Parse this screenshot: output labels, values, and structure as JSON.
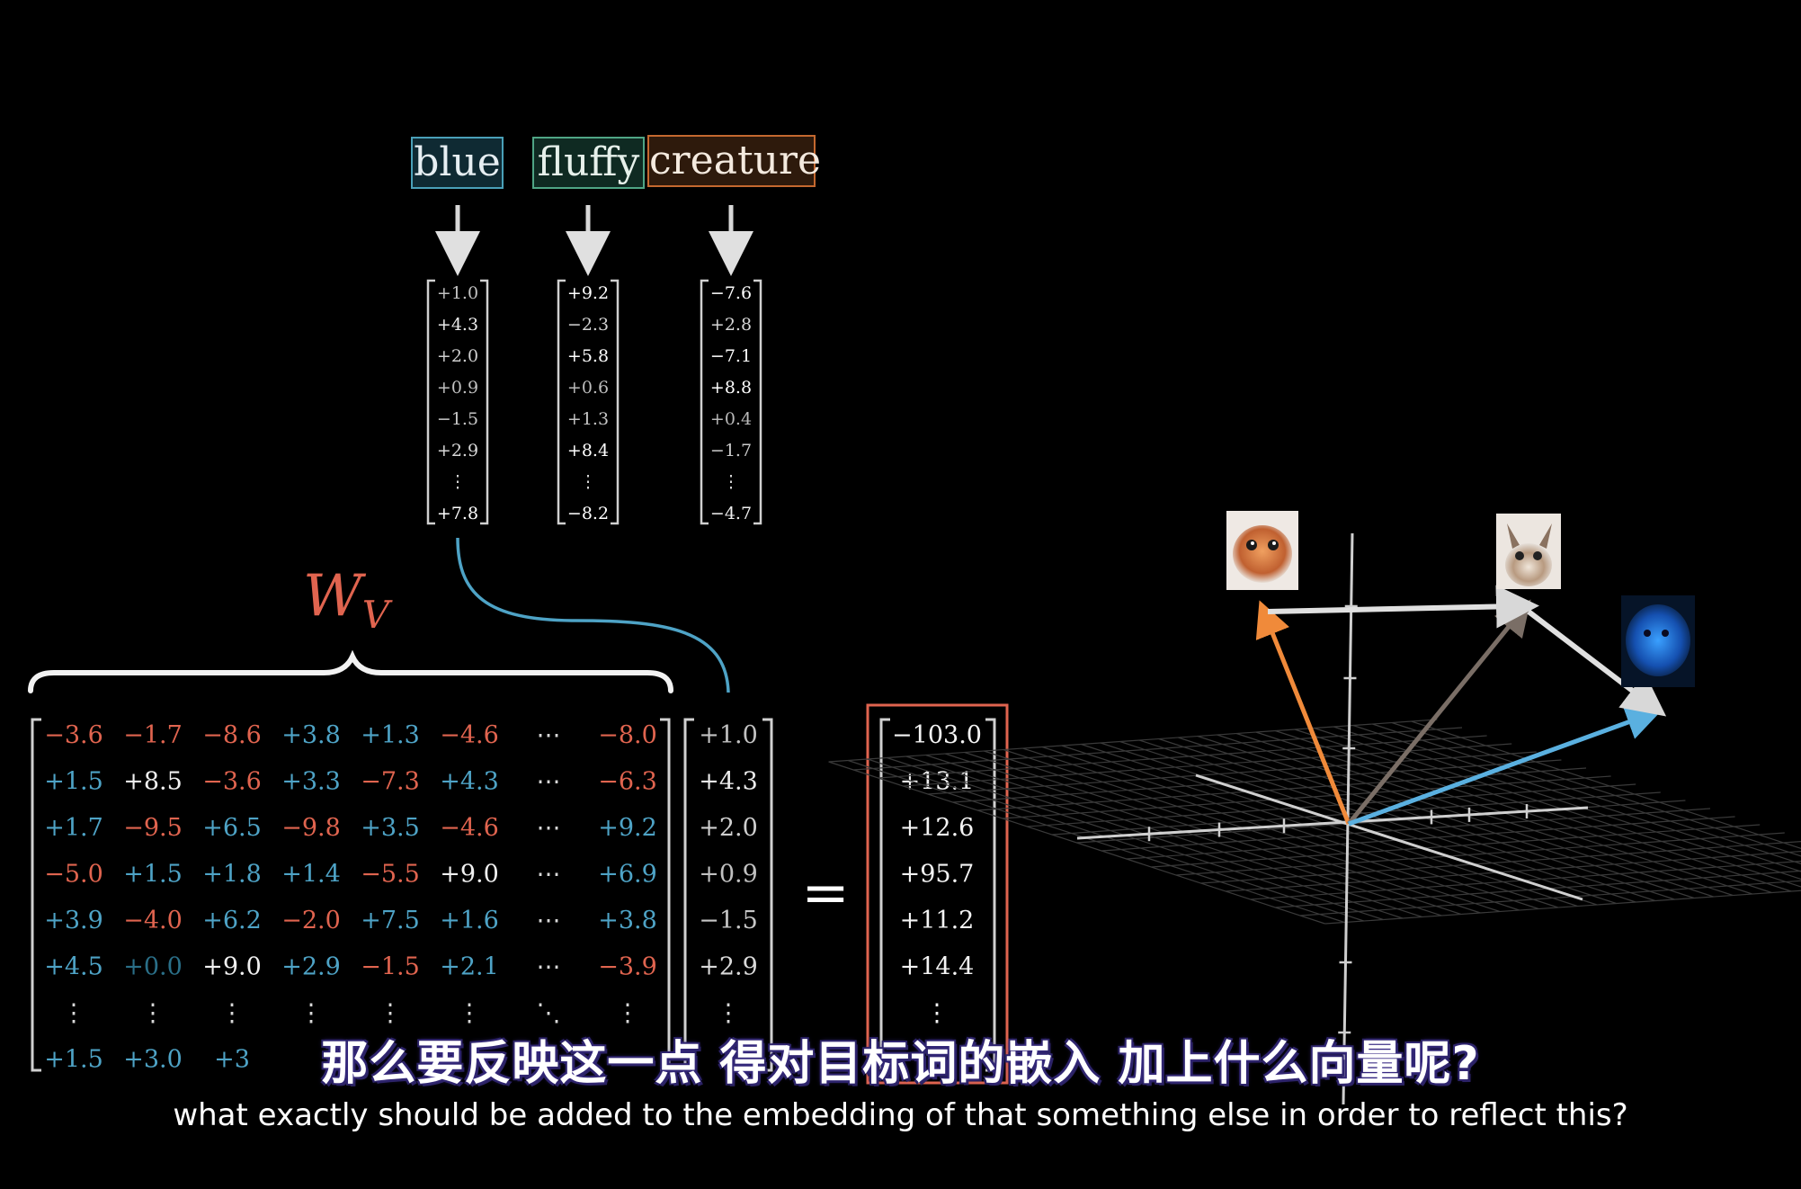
{
  "tokens": [
    {
      "label": "blue",
      "vector": [
        "+1.0",
        "+4.3",
        "+2.0",
        "+0.9",
        "−1.5",
        "+2.9",
        "⋮",
        "+7.8"
      ]
    },
    {
      "label": "fluffy",
      "vector": [
        "+9.2",
        "−2.3",
        "+5.8",
        "+0.6",
        "+1.3",
        "+8.4",
        "⋮",
        "−8.2"
      ]
    },
    {
      "label": "creature",
      "vector": [
        "−7.6",
        "+2.8",
        "−7.1",
        "+8.8",
        "+0.4",
        "−1.7",
        "⋮",
        "−4.7"
      ]
    }
  ],
  "matrix_label": {
    "base": "W",
    "subscript": "V"
  },
  "matrix_rows": [
    [
      "−3.6",
      "−1.7",
      "−8.6",
      "+3.8",
      "+1.3",
      "−4.6",
      "⋯",
      "−8.0"
    ],
    [
      "+1.5",
      "+8.5",
      "−3.6",
      "+3.3",
      "−7.3",
      "+4.3",
      "⋯",
      "−6.3"
    ],
    [
      "+1.7",
      "−9.5",
      "+6.5",
      "−9.8",
      "+3.5",
      "−4.6",
      "⋯",
      "+9.2"
    ],
    [
      "−5.0",
      "+1.5",
      "+1.8",
      "+1.4",
      "−5.5",
      "+9.0",
      "⋯",
      "+6.9"
    ],
    [
      "+3.9",
      "−4.0",
      "+6.2",
      "−2.0",
      "+7.5",
      "+1.6",
      "⋯",
      "+3.8"
    ],
    [
      "+4.5",
      "+0.0",
      "+9.0",
      "+2.9",
      "−1.5",
      "+2.1",
      "⋯",
      "−3.9"
    ],
    [
      "⋮",
      "⋮",
      "⋮",
      "⋮",
      "⋮",
      "⋮",
      "⋱",
      "⋮"
    ],
    [
      "+1.5",
      "+3.0",
      "+3",
      "",
      "",
      "",
      "",
      ""
    ]
  ],
  "input_vector": [
    "+1.0",
    "+4.3",
    "+2.0",
    "+0.9",
    "−1.5",
    "+2.9",
    "⋮"
  ],
  "equals_sign": "=",
  "output_vector": [
    "−103.0",
    "+13.1",
    "+12.6",
    "+95.7",
    "+11.2",
    "+14.4",
    "⋮"
  ],
  "subtitle_cn": "那么要反映这一点 得对目标词的嵌入 加上什么向量呢?",
  "subtitle_en": "what exactly should be added to the embedding of that something else in order to reflect this?",
  "colors": {
    "background": "#000000",
    "negative": "#e0644f",
    "positive": "#4ea3c6",
    "blue_token": "#4aa0b8",
    "fluffy_token": "#4fa585",
    "creature_token": "#c4682f",
    "output_box": "#e0644f",
    "arrow_orange": "#f08a3a",
    "arrow_blue": "#5ab0e0",
    "arrow_gray": "#7a6e66",
    "arrow_white": "#e0e0e0"
  },
  "icons": [
    "orange-creature-image",
    "fluffy-creature-image",
    "blue-fluffy-creature-image"
  ]
}
